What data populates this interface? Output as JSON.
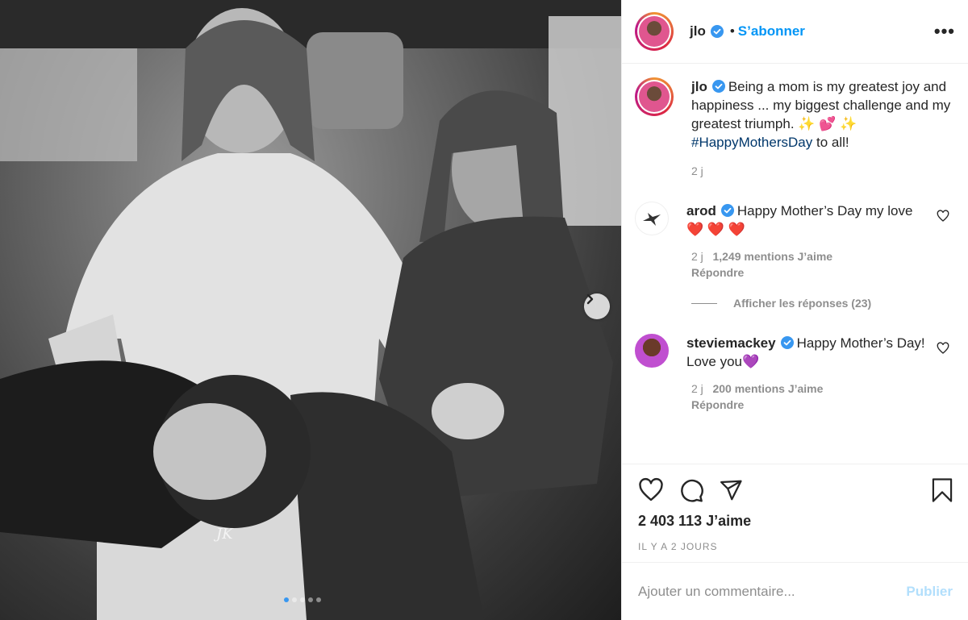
{
  "post": {
    "author": "jlo",
    "follow_label": "S’abonner",
    "more_label": "•••",
    "bullet": "•",
    "caption": "Being a mom is my greatest joy and happiness ... my biggest challenge and my greatest triumph. ✨ 💕 ✨",
    "hashtag": "#HappyMothersDay",
    "caption_end": " to all!",
    "caption_age": "2 j",
    "likes": "2 403 113 J’aime",
    "timestamp": "IL Y A 2 JOURS",
    "carousel": {
      "count": 5,
      "active": 0
    }
  },
  "comments": [
    {
      "user": "arod",
      "text": "Happy Mother’s Day my love❤️ ❤️ ❤️",
      "age": "2 j",
      "likes": "1,249 mentions J’aime",
      "reply": "Répondre",
      "view_replies": "Afficher les réponses (23)"
    },
    {
      "user": "steviemackey",
      "text": "Happy Mother’s Day! Love you💜",
      "age": "2 j",
      "likes": "200 mentions J’aime",
      "reply": "Répondre"
    }
  ],
  "composer": {
    "placeholder": "Ajouter un commentaire...",
    "publish": "Publier"
  },
  "watermark": "JK",
  "colors": {
    "link": "#0095f6",
    "hashtag": "#00376b",
    "muted": "#8e8e8e",
    "publish_disabled": "#b2dffc",
    "verified": "#3897f0"
  },
  "icons": [
    "verified-icon",
    "more-icon",
    "heart-icon",
    "comment-icon",
    "share-icon",
    "bookmark-icon",
    "chevron-right-icon"
  ]
}
